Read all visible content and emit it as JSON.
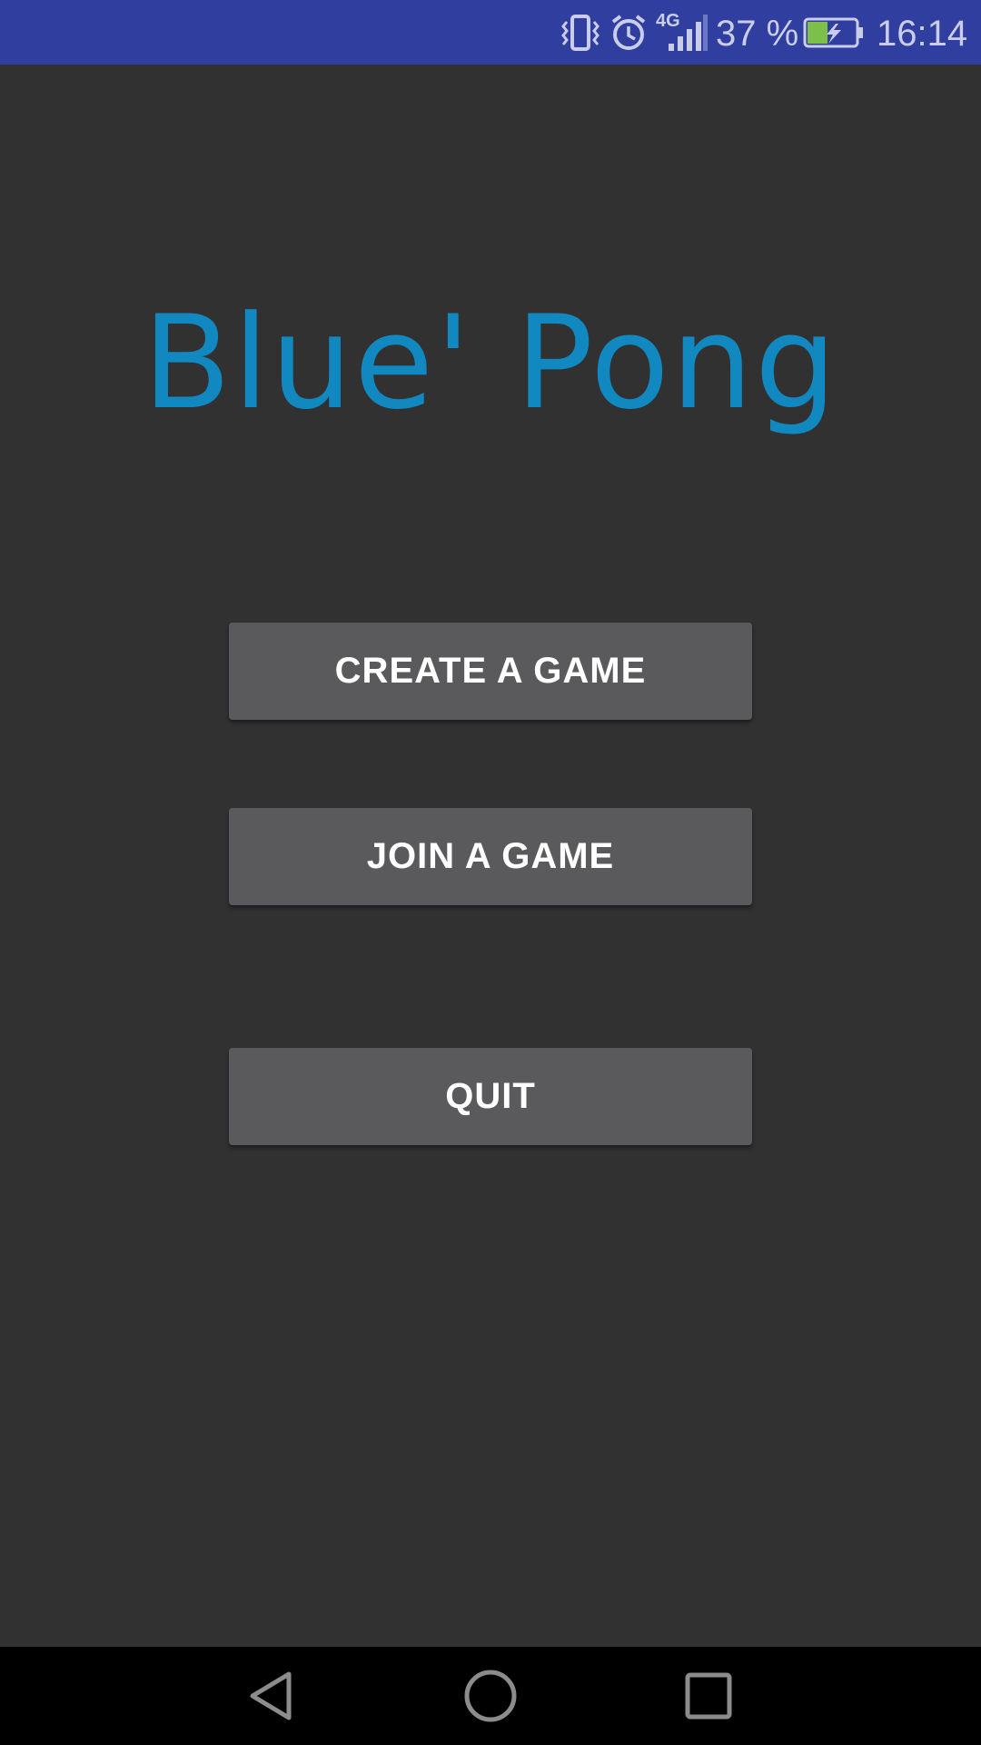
{
  "status_bar": {
    "battery_percent": "37 %",
    "time": "16:14",
    "network_type": "4G",
    "icons": [
      "vibrate-icon",
      "alarm-icon",
      "signal-icon",
      "battery-charging-icon"
    ],
    "background_color": "#303f9f"
  },
  "app": {
    "title": "Blue' Pong",
    "title_color": "#1188c0",
    "background_color": "#313131"
  },
  "menu": {
    "create_label": "CREATE A GAME",
    "join_label": "JOIN A GAME",
    "quit_label": "QUIT",
    "button_color": "#5a5a5c"
  },
  "nav_bar": {
    "icons": [
      "back-icon",
      "home-icon",
      "recents-icon"
    ]
  }
}
